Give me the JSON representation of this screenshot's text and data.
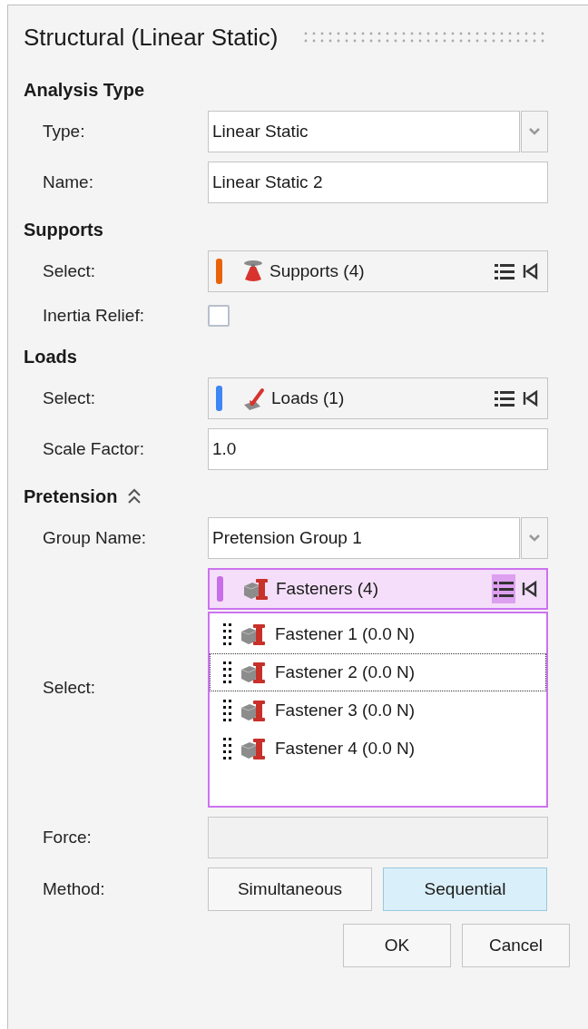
{
  "title": "Structural (Linear Static)",
  "sections": [
    {
      "heading": "Analysis Type",
      "rows": [
        {
          "kind": "dropdown",
          "label": "Type:",
          "value": "Linear Static"
        },
        {
          "kind": "text",
          "label": "Name:",
          "value": "Linear Static 2"
        }
      ]
    },
    {
      "heading": "Supports",
      "rows": [
        {
          "kind": "collection",
          "label": "Select:",
          "value": "Supports (4)",
          "color": "#e8630a",
          "active": false
        },
        {
          "kind": "checkbox",
          "label": "Inertia Relief:",
          "checked": false
        }
      ]
    },
    {
      "heading": "Loads",
      "rows": [
        {
          "kind": "collection",
          "label": "Select:",
          "value": "Loads (1)",
          "color": "#3f86f5",
          "active": false
        },
        {
          "kind": "text",
          "label": "Scale Factor:",
          "value": "1.0"
        }
      ]
    },
    {
      "heading": "Pretension",
      "expanded": true,
      "rows": [
        {
          "kind": "dropdown",
          "label": "Group Name:",
          "value": "Pretension Group 1"
        },
        {
          "kind": "collection_list",
          "label": "Select:",
          "value": "Fasteners (4)",
          "color": "#c86ee8",
          "active": true,
          "items": [
            {
              "label": "Fastener 1 (0.0 N)",
              "focused": false
            },
            {
              "label": "Fastener 2 (0.0 N)",
              "focused": true
            },
            {
              "label": "Fastener 3 (0.0 N)",
              "focused": false
            },
            {
              "label": "Fastener 4 (0.0 N)",
              "focused": false
            }
          ]
        },
        {
          "kind": "empty_field",
          "label": "Force:"
        },
        {
          "kind": "toggle",
          "label": "Method:",
          "options": [
            {
              "label": "Simultaneous",
              "selected": false
            },
            {
              "label": "Sequential",
              "selected": true
            }
          ]
        }
      ]
    }
  ],
  "buttons": [
    "OK",
    "Cancel"
  ]
}
